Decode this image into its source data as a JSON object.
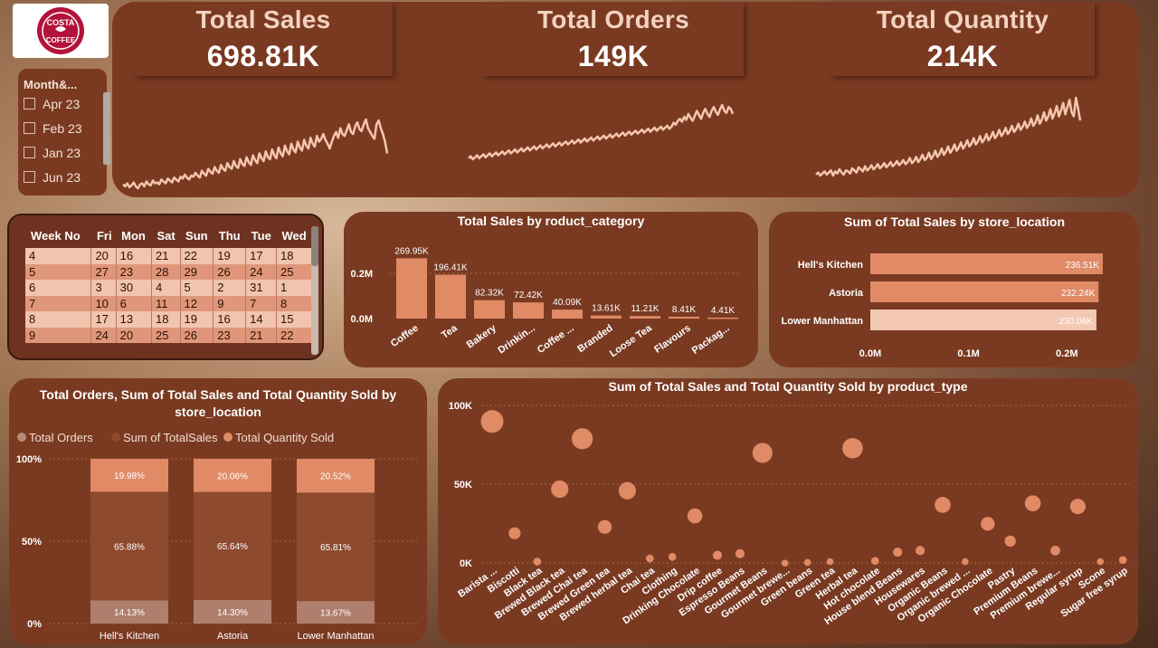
{
  "logo": {
    "brand": "COSTA COFFEE"
  },
  "kpis": [
    {
      "title": "Total Sales",
      "value": "698.81K"
    },
    {
      "title": "Total Orders",
      "value": "149K"
    },
    {
      "title": "Total Quantity",
      "value": "214K"
    }
  ],
  "slicer": {
    "title": "Month&...",
    "items": [
      "Apr 23",
      "Feb 23",
      "Jan 23",
      "Jun 23"
    ]
  },
  "week_table": {
    "headers": [
      "Week No",
      "Fri",
      "Mon",
      "Sat",
      "Sun",
      "Thu",
      "Tue",
      "Wed"
    ],
    "rows": [
      [
        "4",
        "20",
        "16",
        "21",
        "22",
        "19",
        "17",
        "18"
      ],
      [
        "5",
        "27",
        "23",
        "28",
        "29",
        "26",
        "24",
        "25"
      ],
      [
        "6",
        "3",
        "30",
        "4",
        "5",
        "2",
        "31",
        "1"
      ],
      [
        "7",
        "10",
        "6",
        "11",
        "12",
        "9",
        "7",
        "8"
      ],
      [
        "8",
        "17",
        "13",
        "18",
        "19",
        "16",
        "14",
        "15"
      ],
      [
        "9",
        "24",
        "20",
        "25",
        "26",
        "23",
        "21",
        "22"
      ]
    ]
  },
  "colors": {
    "panel": "#7a3a22",
    "accent": "#e08a66",
    "light": "#f3c9b3",
    "mid": "#8e4a2e",
    "line": "#f5c6ad"
  },
  "chart_data": [
    {
      "type": "line",
      "id": "sales-trend",
      "x_label": "",
      "values": [
        8,
        6,
        9,
        5,
        7,
        10,
        6,
        4,
        8,
        9,
        6,
        11,
        8,
        7,
        12,
        9,
        10,
        8,
        13,
        11,
        9,
        14,
        12,
        10,
        15,
        13,
        11,
        16,
        14,
        18,
        15,
        13,
        17,
        16,
        20,
        17,
        15,
        22,
        19,
        17,
        24,
        21,
        19,
        26,
        22,
        20,
        28,
        24,
        22,
        30,
        26,
        24,
        32,
        27,
        25,
        34,
        29,
        27,
        36,
        31,
        28,
        38,
        33,
        30,
        40,
        35,
        32,
        42,
        36,
        34,
        44,
        38,
        35,
        46,
        40,
        37,
        48,
        42,
        39,
        50,
        44,
        41,
        52,
        46,
        43,
        54,
        48,
        45,
        56,
        50,
        47,
        58,
        52,
        55,
        60,
        54,
        50,
        45,
        52,
        58,
        62,
        56,
        66,
        60,
        58,
        64,
        70,
        62,
        60,
        68,
        72,
        65,
        63,
        70,
        75,
        66,
        62,
        58,
        55,
        70,
        74,
        66,
        60,
        52,
        40
      ]
    },
    {
      "type": "line",
      "id": "orders-trend",
      "values": [
        10,
        12,
        9,
        11,
        13,
        10,
        12,
        14,
        11,
        13,
        15,
        12,
        14,
        16,
        13,
        15,
        17,
        14,
        16,
        18,
        15,
        17,
        19,
        16,
        18,
        20,
        17,
        19,
        21,
        18,
        20,
        22,
        19,
        21,
        23,
        20,
        22,
        24,
        21,
        23,
        25,
        22,
        24,
        26,
        23,
        25,
        27,
        24,
        26,
        28,
        25,
        27,
        29,
        26,
        28,
        30,
        27,
        29,
        31,
        28,
        30,
        32,
        29,
        31,
        33,
        30,
        32,
        34,
        31,
        33,
        35,
        32,
        34,
        36,
        33,
        35,
        37,
        34,
        36,
        38,
        35,
        37,
        39,
        36,
        38,
        40,
        37,
        39,
        41,
        38,
        40,
        42,
        39,
        41,
        43,
        40,
        42,
        46,
        44,
        48,
        50,
        47,
        52,
        49,
        55,
        51,
        48,
        53,
        58,
        54,
        50,
        56,
        60,
        55,
        52,
        58,
        62,
        57,
        54,
        60,
        64,
        58,
        56,
        62,
        60,
        55
      ]
    },
    {
      "type": "line",
      "id": "quantity-trend",
      "values": [
        6,
        8,
        5,
        7,
        9,
        6,
        8,
        10,
        5,
        9,
        7,
        11,
        8,
        6,
        10,
        9,
        7,
        12,
        10,
        8,
        13,
        11,
        9,
        14,
        10,
        12,
        15,
        11,
        13,
        16,
        12,
        14,
        17,
        13,
        15,
        18,
        14,
        16,
        19,
        15,
        17,
        20,
        16,
        18,
        22,
        17,
        19,
        23,
        18,
        21,
        25,
        20,
        22,
        27,
        21,
        24,
        29,
        23,
        26,
        31,
        25,
        28,
        33,
        27,
        30,
        35,
        29,
        32,
        37,
        31,
        34,
        39,
        33,
        36,
        41,
        35,
        38,
        43,
        37,
        40,
        45,
        39,
        42,
        47,
        41,
        44,
        49,
        43,
        46,
        51,
        45,
        48,
        53,
        47,
        50,
        55,
        49,
        52,
        57,
        51,
        54,
        60,
        53,
        56,
        63,
        55,
        59,
        66,
        58,
        62,
        69,
        60,
        65,
        72,
        62,
        68,
        75,
        64,
        71,
        78,
        66,
        62,
        80,
        70,
        58
      ]
    },
    {
      "type": "bar",
      "id": "sales-by-category",
      "title": "Total Sales by roduct_category",
      "categories": [
        "Coffee",
        "Tea",
        "Bakery",
        "Drinkin...",
        "Coffee ...",
        "Branded",
        "Loose Tea",
        "Flavours",
        "Packag..."
      ],
      "values": [
        269950,
        196410,
        82320,
        72420,
        40090,
        13610,
        11210,
        8410,
        4410
      ],
      "data_labels": [
        "269.95K",
        "196.41K",
        "82.32K",
        "72.42K",
        "40.09K",
        "13.61K",
        "11.21K",
        "8.41K",
        "4.41K"
      ],
      "y_ticks": [
        "0.2M",
        "0.0M"
      ],
      "ylim": [
        0,
        300000
      ]
    },
    {
      "type": "bar",
      "id": "sales-by-store",
      "orientation": "horizontal",
      "title": "Sum of Total Sales by store_location",
      "categories": [
        "Hell's Kitchen",
        "Astoria",
        "Lower Manhattan"
      ],
      "values": [
        236510,
        232240,
        230060
      ],
      "data_labels": [
        "236.51K",
        "232.24K",
        "230.06K"
      ],
      "x_ticks": [
        "0.0M",
        "0.1M",
        "0.2M"
      ],
      "xlim": [
        0,
        250000
      ]
    },
    {
      "type": "bar",
      "id": "stacked-by-store",
      "stacked": "100%",
      "title": "Total Orders, Sum of Total Sales and Total Quantity Sold by store_location",
      "legend": [
        "Total Orders",
        "Sum of TotalSales",
        "Total Quantity Sold"
      ],
      "categories": [
        "Hell's Kitchen",
        "Astoria",
        "Lower Manhattan"
      ],
      "series": [
        {
          "name": "Total Orders",
          "values": [
            14.13,
            14.3,
            13.67
          ],
          "labels": [
            "14.13%",
            "14.30%",
            "13.67%"
          ]
        },
        {
          "name": "Sum of TotalSales",
          "values": [
            65.88,
            65.64,
            65.81
          ],
          "labels": [
            "65.88%",
            "65.64%",
            "65.81%"
          ]
        },
        {
          "name": "Total Quantity Sold",
          "values": [
            19.98,
            20.06,
            20.52
          ],
          "labels": [
            "19.98%",
            "20.06%",
            "20.52%"
          ]
        }
      ],
      "y_ticks": [
        "100%",
        "50%",
        "0%"
      ]
    },
    {
      "type": "scatter",
      "id": "sales-qty-by-type",
      "title": "Sum of Total Sales and Total Quantity Sold by product_type",
      "categories": [
        "Barista ...",
        "Biscotti",
        "Black tea",
        "Brewed Black tea",
        "Brewed Chai tea",
        "Brewed Green tea",
        "Brewed herbal tea",
        "Chai tea",
        "Clothing",
        "Drinking Chocolate",
        "Drip coffee",
        "Espresso Beans",
        "Gourmet Beans",
        "Gourmet brewe...",
        "Green beans",
        "Green tea",
        "Herbal tea",
        "Hot chocolate",
        "House blend Beans",
        "Housewares",
        "Organic Beans",
        "Organic brewed ...",
        "Organic Chocolate",
        "Pastry",
        "Premium Beans",
        "Premium brewe...",
        "Regular syrup",
        "Scone",
        "Sugar free syrup"
      ],
      "sales": [
        91000,
        20000,
        2000,
        48000,
        80000,
        24000,
        47000,
        4000,
        5000,
        31000,
        6000,
        7000,
        71000,
        1000,
        1500,
        2000,
        74000,
        2500,
        8000,
        9000,
        38000,
        2000,
        26000,
        15000,
        39000,
        9000,
        37000,
        2000,
        3000
      ],
      "quantity": [
        30000,
        5000,
        1000,
        15000,
        25000,
        8000,
        15000,
        1000,
        1000,
        10000,
        2000,
        2000,
        22000,
        500,
        500,
        500,
        23000,
        1000,
        2000,
        2000,
        12000,
        500,
        8000,
        4000,
        12000,
        2500,
        11000,
        500,
        1000
      ],
      "y_ticks": [
        "100K",
        "50K",
        "0K"
      ],
      "ylim": [
        0,
        100000
      ]
    }
  ]
}
